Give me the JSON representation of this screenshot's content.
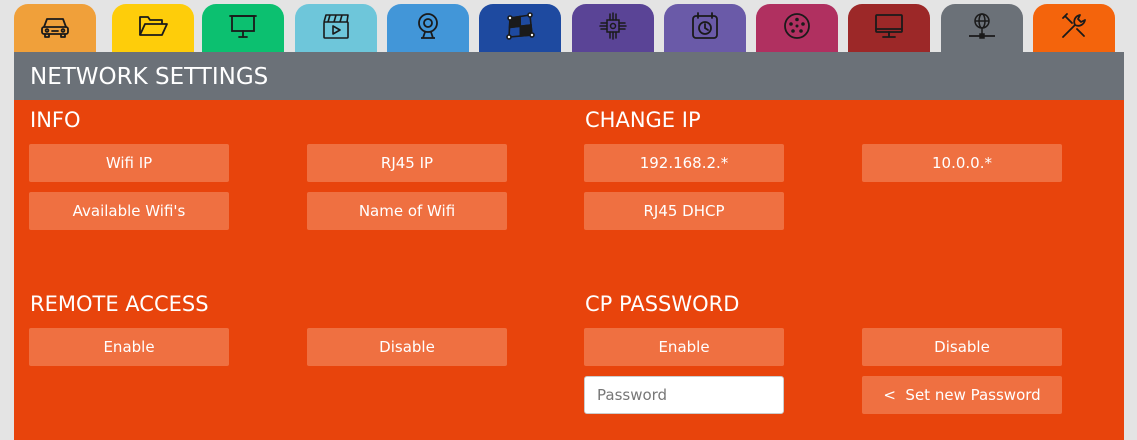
{
  "tabs": [
    {
      "icon": "car-icon",
      "color": "#f0a03a"
    },
    {
      "icon": "folder-icon",
      "color": "#fecd0a"
    },
    {
      "icon": "projector-screen-icon",
      "color": "#0cc070"
    },
    {
      "icon": "clapperboard-icon",
      "color": "#6ec6da"
    },
    {
      "icon": "webcam-icon",
      "color": "#4296d8"
    },
    {
      "icon": "mapping-grid-icon",
      "color": "#1e4aa0"
    },
    {
      "icon": "chip-icon",
      "color": "#5a4496"
    },
    {
      "icon": "calendar-clock-icon",
      "color": "#6a5aa8"
    },
    {
      "icon": "dmx-connector-icon",
      "color": "#b03060"
    },
    {
      "icon": "monitor-icon",
      "color": "#9c2828"
    },
    {
      "icon": "network-icon",
      "color": "#6b7178",
      "active": true
    },
    {
      "icon": "tools-icon",
      "color": "#f4640c"
    }
  ],
  "header": {
    "title": "NETWORK SETTINGS"
  },
  "info": {
    "title": "INFO",
    "wifi_ip": "Wifi IP",
    "rj45_ip": "RJ45 IP",
    "available_wifis": "Available Wifi's",
    "name_of_wifi": "Name of Wifi"
  },
  "change_ip": {
    "title": "CHANGE IP",
    "ip_192": "192.168.2.*",
    "ip_10": "10.0.0.*",
    "rj45_dhcp": "RJ45 DHCP"
  },
  "remote_access": {
    "title": "REMOTE ACCESS",
    "enable": "Enable",
    "disable": "Disable"
  },
  "cp_password": {
    "title": "CP PASSWORD",
    "enable": "Enable",
    "disable": "Disable",
    "placeholder": "Password",
    "set_new": "<  Set new Password"
  },
  "colors": {
    "panel": "#e8440c",
    "button": "#ef7041",
    "header": "#6b7178"
  }
}
